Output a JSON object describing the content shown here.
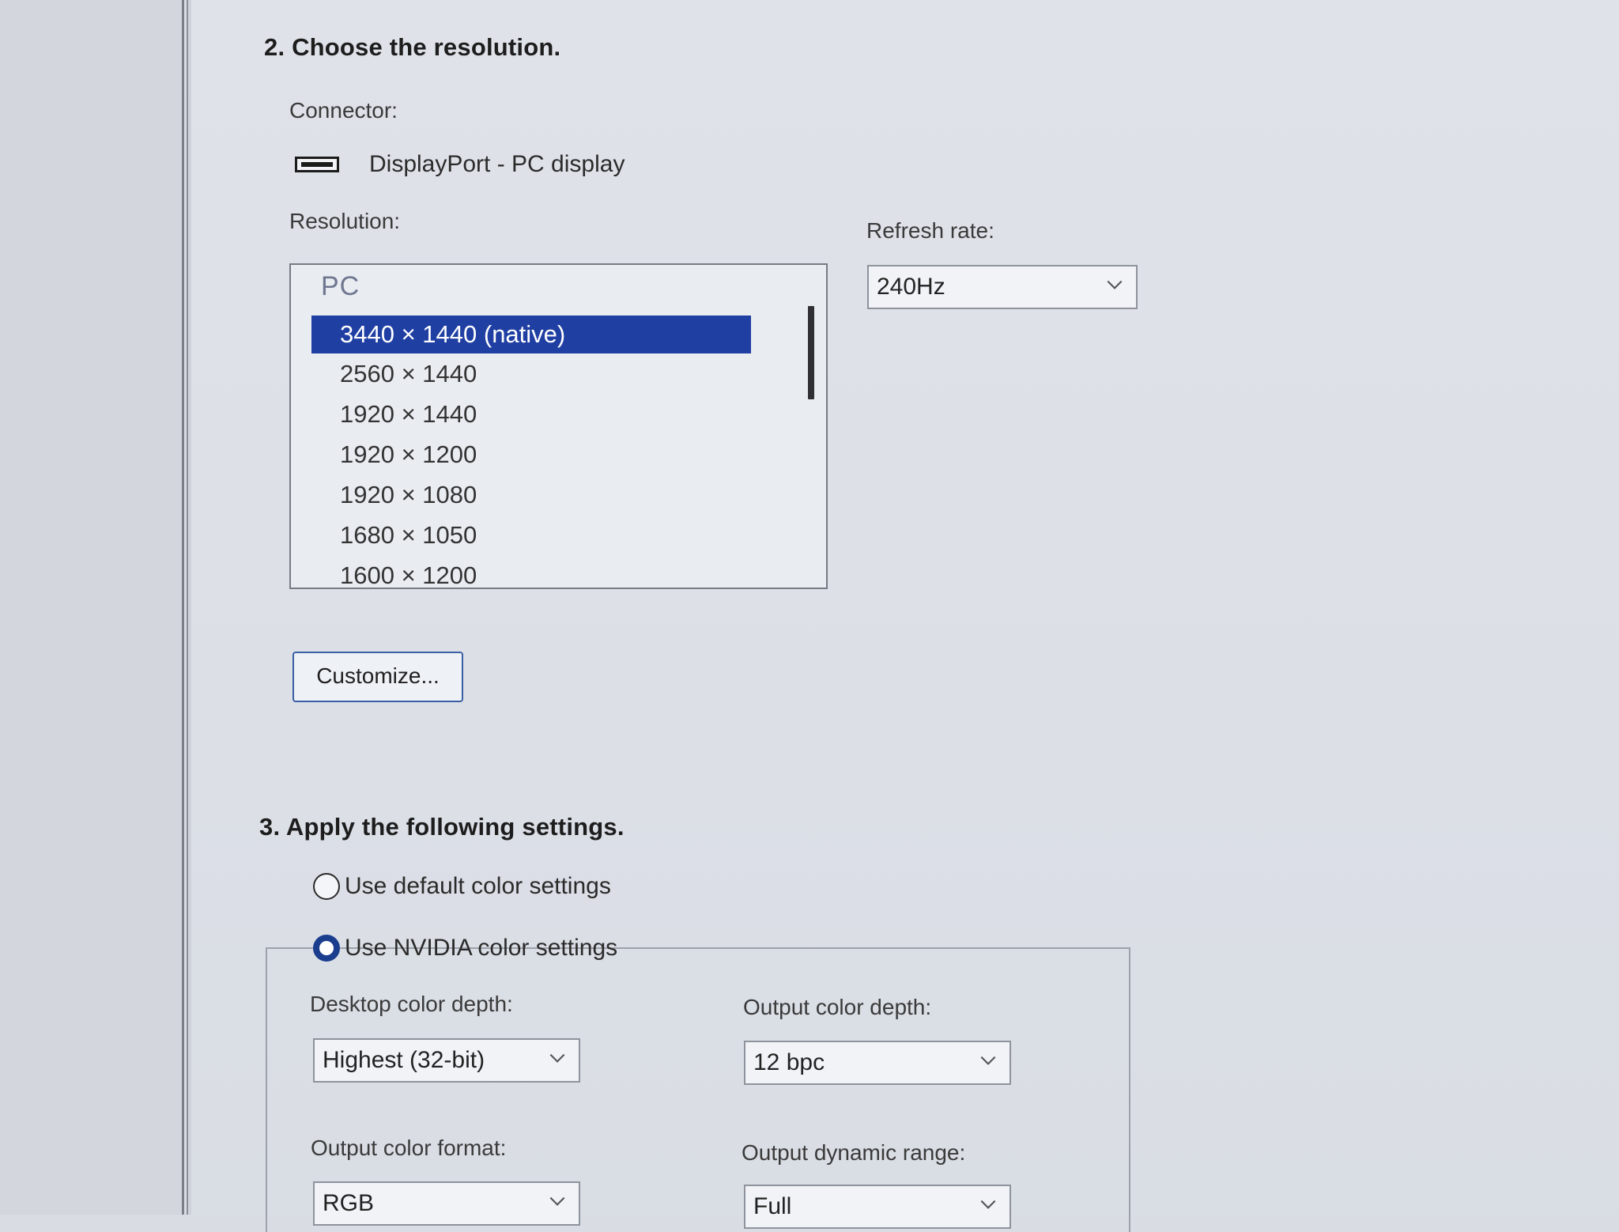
{
  "section2": {
    "title": "2. Choose the resolution.",
    "connector_label": "Connector:",
    "connector_value": "DisplayPort - PC display",
    "resolution_label": "Resolution:",
    "refresh_label": "Refresh rate:",
    "refresh_value": "240Hz",
    "list_group": "PC",
    "resolutions": [
      "3440 × 1440 (native)",
      "2560 × 1440",
      "1920 × 1440",
      "1920 × 1200",
      "1920 × 1080",
      "1680 × 1050",
      "1600 × 1200"
    ],
    "selected_index": 0,
    "customize_button": "Customize..."
  },
  "section3": {
    "title": "3. Apply the following settings.",
    "radio_default": "Use default color settings",
    "radio_nvidia": "Use NVIDIA color settings",
    "desktop_depth_label": "Desktop color depth:",
    "desktop_depth_value": "Highest (32-bit)",
    "output_depth_label": "Output color depth:",
    "output_depth_value": "12 bpc",
    "output_format_label": "Output color format:",
    "output_format_value": "RGB",
    "output_range_label": "Output dynamic range:",
    "output_range_value": "Full"
  },
  "icons": {
    "connector": "displayport-icon",
    "dropdown": "chevron-down-icon"
  },
  "colors": {
    "selection": "#1f3fa3",
    "radio_checked": "#1a3d8e"
  }
}
